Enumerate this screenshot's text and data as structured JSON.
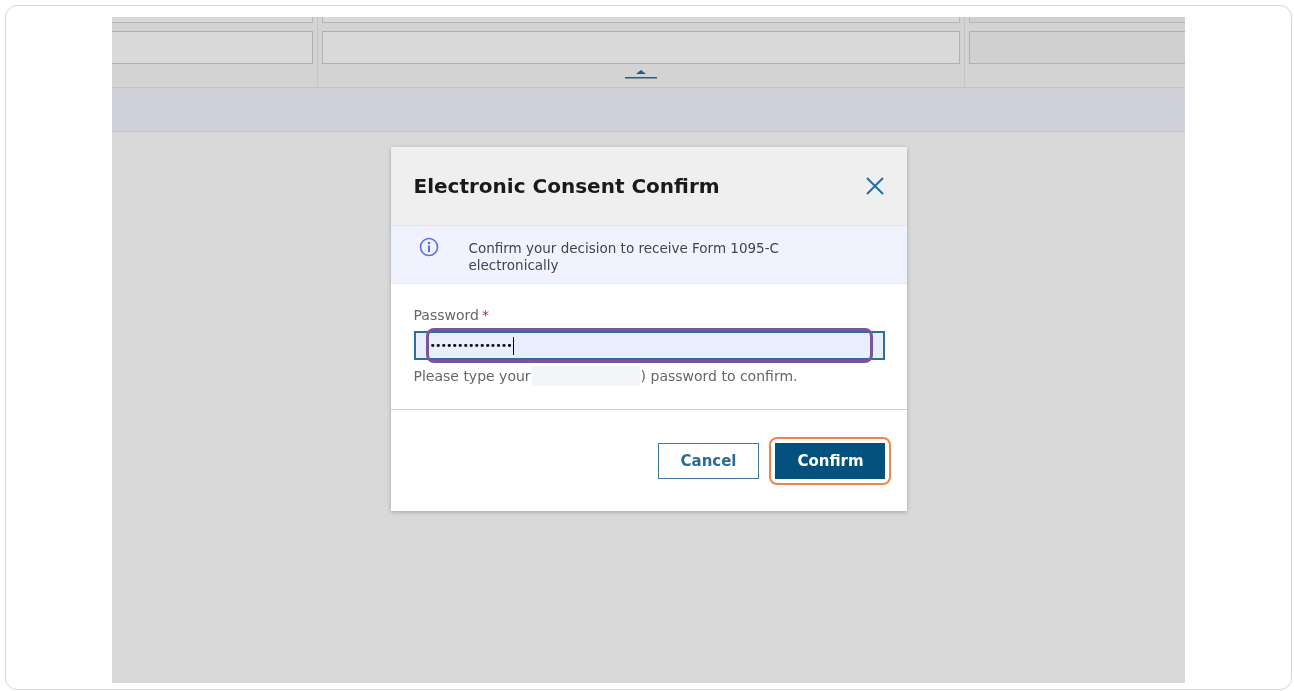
{
  "dialog": {
    "title": "Electronic Consent Confirm",
    "notice": "Confirm your decision to receive Form 1095-C electronically",
    "password": {
      "label": "Password",
      "required_mark": "*",
      "value": "•••••••••••••••",
      "highlighted": true,
      "help_before": "Please type your",
      "help_after": ") password to confirm."
    },
    "buttons": [
      {
        "kind": "secondary",
        "label": "Cancel",
        "highlighted": false
      },
      {
        "kind": "primary",
        "label": "Confirm",
        "highlighted": true
      }
    ]
  }
}
